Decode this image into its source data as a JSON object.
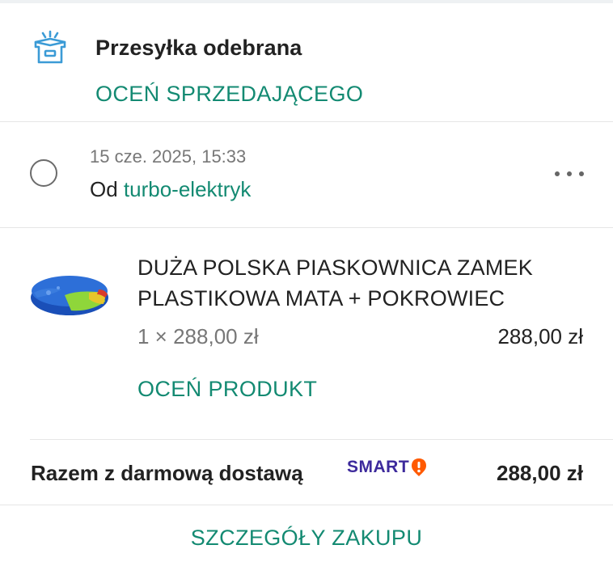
{
  "header": {
    "icon": "package-open-icon",
    "title": "Przesyłka odebrana",
    "rate_seller_label": "OCEŃ SPRZEDAJĄCEGO"
  },
  "order": {
    "date": "15 cze. 2025, 15:33",
    "from_prefix": "Od",
    "seller": "turbo-elektryk",
    "more_icon": "more-horizontal-icon"
  },
  "product": {
    "image": "sandbox-product-thumbnail",
    "title": "DUŻA POLSKA PIASKOWNICA ZAMEK PLASTIKOWA MATA + POKROWIEC",
    "quantity_price": "1 × 288,00 zł",
    "line_total": "288,00 zł",
    "rate_product_label": "OCEŃ PRODUKT"
  },
  "summary": {
    "total_label": "Razem z darmową dostawą",
    "smart_label": "SMART",
    "total_price": "288,00 zł"
  },
  "footer": {
    "purchase_details_label": "SZCZEGÓŁY ZAKUPU"
  },
  "colors": {
    "accent_green": "#138a72",
    "smart_purple": "#3d2a9c",
    "smart_orange": "#ff5a00",
    "icon_blue": "#3b9bd6"
  }
}
